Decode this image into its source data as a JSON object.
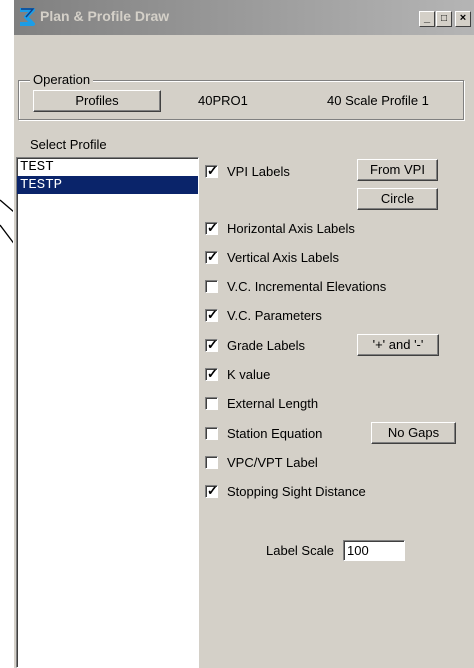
{
  "window": {
    "title": "Plan & Profile Draw",
    "controls": {
      "minimize": "_",
      "maximize": "□",
      "close": "×"
    }
  },
  "operation": {
    "group_label": "Operation",
    "button_label": "Profiles",
    "code": "40PRO1",
    "description": "40 Scale Profile 1"
  },
  "select_profile": {
    "label": "Select Profile",
    "items": [
      "TEST",
      "TESTP"
    ],
    "selected": "TESTP"
  },
  "options": [
    {
      "label": "VPI Labels",
      "checked": true
    },
    {
      "label": "Horizontal Axis Labels",
      "checked": true
    },
    {
      "label": "Vertical Axis Labels",
      "checked": true
    },
    {
      "label": "V.C. Incremental Elevations",
      "checked": false
    },
    {
      "label": "V.C. Parameters",
      "checked": true
    },
    {
      "label": "Grade Labels",
      "checked": true
    },
    {
      "label": "K value",
      "checked": true
    },
    {
      "label": "External Length",
      "checked": false
    },
    {
      "label": "Station Equation",
      "checked": false
    },
    {
      "label": "VPC/VPT Label",
      "checked": false
    },
    {
      "label": "Stopping Sight Distance",
      "checked": true
    }
  ],
  "buttons": {
    "from_vpi": "From VPI",
    "circle": "Circle",
    "grade_signs": "'+' and '-'",
    "no_gaps": "No Gaps"
  },
  "label_scale": {
    "label": "Label Scale",
    "value": "100"
  },
  "check_glyph": "✓",
  "colors": {
    "selection": "#0a246a",
    "dialog": "#d4d0c8",
    "titlebar_start": "#808080"
  }
}
